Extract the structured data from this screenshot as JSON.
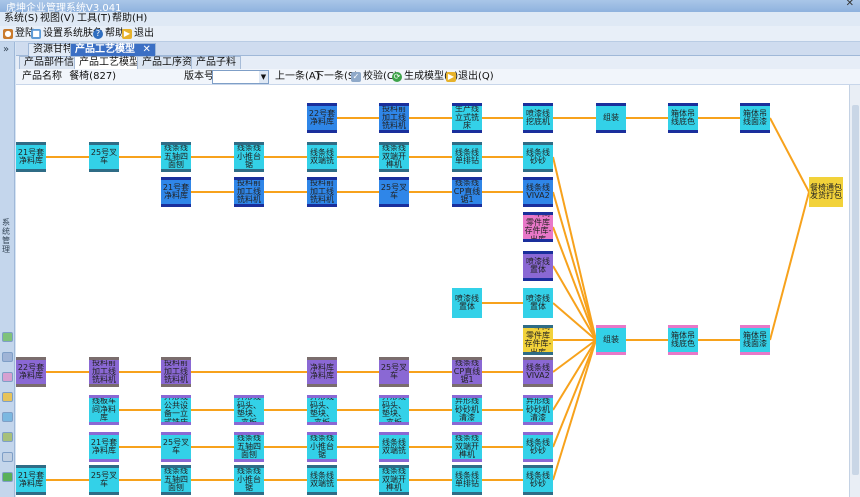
{
  "window": {
    "title": "虎坤企业管理系统V3.041",
    "close_glyph": "✕"
  },
  "menu": [
    "系统(S)",
    "视图(V)",
    "工具(T)",
    "帮助(H)"
  ],
  "toolbar": {
    "logout": "登陆",
    "theme": "设置系统肤色",
    "help": "帮助",
    "exit": "退出"
  },
  "left_strip": {
    "chevron": "»",
    "vertical_label": "系统管理"
  },
  "doc_tabs": [
    {
      "label": "资源甘特图"
    },
    {
      "label": "产品工艺模型"
    }
  ],
  "doc_tab_close": "✕",
  "sub_tabs": [
    "产品部件信息",
    "产品工艺模型图",
    "产品工序资料",
    "产品子料"
  ],
  "params": {
    "product_name_label": "产品名称",
    "product_name_value": "餐椅(827)",
    "version_label": "版本号",
    "version_value": "",
    "prev": "上一条(A)",
    "next": "下一条(S)",
    "check": "校验(C)",
    "generate": "生成模型(E)",
    "exit": "退出(Q)"
  },
  "colors": {
    "cyan": "#33d1e8",
    "blue": "#2f86e8",
    "purple": "#8a68d4",
    "pink": "#e878c8",
    "teal_band": "#2f6c86",
    "dark_band": "#1a2f9c",
    "gray_band": "#7a6d6d",
    "yellow": "#f2d23a",
    "orange_edge": "#f7a21c"
  },
  "nodes": [
    {
      "id": "n1",
      "label": "22号套净料库",
      "col": 6,
      "row": 0,
      "style": "blue",
      "band": "dark"
    },
    {
      "id": "n2",
      "label": "投料前加工线铣料机",
      "col": 7,
      "row": 0,
      "style": "blue",
      "band": "dark"
    },
    {
      "id": "n3",
      "label": "生产线立式铣床",
      "col": 8,
      "row": 0,
      "style": "cyan",
      "band": "dark"
    },
    {
      "id": "n4",
      "label": "喷漆线挖底机",
      "col": 9,
      "row": 0,
      "style": "cyan",
      "band": "dark"
    },
    {
      "id": "n5",
      "label": "组装",
      "col": 10,
      "row": 0,
      "style": "cyan",
      "band": "dark"
    },
    {
      "id": "n6",
      "label": "箱体吊线底色",
      "col": 11,
      "row": 0,
      "style": "cyan",
      "band": "dark"
    },
    {
      "id": "n7",
      "label": "箱体吊线面漆",
      "col": 12,
      "row": 0,
      "style": "cyan",
      "band": "dark"
    },
    {
      "id": "n8",
      "label": "21号套净料库",
      "col": 0,
      "row": 1,
      "style": "cyan",
      "band": "teal"
    },
    {
      "id": "n9",
      "label": "25号叉车",
      "col": 2,
      "row": 1,
      "style": "cyan",
      "band": "teal"
    },
    {
      "id": "n10",
      "label": "线条线五轴四面刨",
      "col": 4,
      "row": 1,
      "style": "cyan",
      "band": "teal"
    },
    {
      "id": "n11",
      "label": "线条线小推台锯",
      "col": 5,
      "row": 1,
      "style": "cyan",
      "band": "teal"
    },
    {
      "id": "n12",
      "label": "线条线双端铣",
      "col": 6,
      "row": 1,
      "style": "cyan",
      "band": "teal"
    },
    {
      "id": "n13",
      "label": "线条线双端开榫机",
      "col": 7,
      "row": 1,
      "style": "cyan",
      "band": "teal"
    },
    {
      "id": "n14",
      "label": "线条线单排钻",
      "col": 8,
      "row": 1,
      "style": "cyan",
      "band": "teal"
    },
    {
      "id": "n15",
      "label": "线条线砂砂",
      "col": 9,
      "row": 1,
      "style": "cyan",
      "band": "teal"
    },
    {
      "id": "n16",
      "label": "21号套净料库",
      "col": 4,
      "row": 2,
      "style": "blue",
      "band": "dark"
    },
    {
      "id": "n17",
      "label": "投料前加工线铣料机",
      "col": 5,
      "row": 2,
      "style": "blue",
      "band": "dark"
    },
    {
      "id": "n18",
      "label": "投料前加工线铣料机",
      "col": 6,
      "row": 2,
      "style": "blue",
      "band": "dark"
    },
    {
      "id": "n19",
      "label": "25号叉车",
      "col": 7,
      "row": 2,
      "style": "blue",
      "band": "dark"
    },
    {
      "id": "n20",
      "label": "线条线CP直线锯1",
      "col": 8,
      "row": 2,
      "style": "blue",
      "band": "dark"
    },
    {
      "id": "n21",
      "label": "线条线VIVA2",
      "col": 9,
      "row": 2,
      "style": "blue",
      "band": "dark"
    },
    {
      "id": "n22",
      "label": "餐椅通包发货打包",
      "col": 13,
      "row": 2,
      "style": "yellow",
      "band": "none"
    },
    {
      "id": "n23",
      "label": "一车间零件库存件库-出库",
      "col": 9,
      "row": 3,
      "style": "pink",
      "band": "dark"
    },
    {
      "id": "n24",
      "label": "喷漆线置体",
      "col": 9,
      "row": 4,
      "style": "purple",
      "band": "dark"
    },
    {
      "id": "n25",
      "label": "喷漆线置体",
      "col": 8,
      "row": 5,
      "style": "cyan",
      "band": "none"
    },
    {
      "id": "n26",
      "label": "喷漆线置体",
      "col": 9,
      "row": 5,
      "style": "cyan",
      "band": "none"
    },
    {
      "id": "n27",
      "label": "一车间零件库存件库-出库",
      "col": 9,
      "row": 6,
      "style": "yellow",
      "band": "teal"
    },
    {
      "id": "n28",
      "label": "组装",
      "col": 10,
      "row": 6,
      "style": "cyan",
      "band": "pink"
    },
    {
      "id": "n29",
      "label": "箱体吊线底色",
      "col": 11,
      "row": 6,
      "style": "cyan",
      "band": "pink"
    },
    {
      "id": "n30",
      "label": "箱体吊线面漆",
      "col": 12,
      "row": 6,
      "style": "cyan",
      "band": "pink"
    },
    {
      "id": "n31",
      "label": "22号套净料库",
      "col": 0,
      "row": 7,
      "style": "purple",
      "band": "gray"
    },
    {
      "id": "n32",
      "label": "投料前加工线铣料机",
      "col": 2,
      "row": 7,
      "style": "purple",
      "band": "gray"
    },
    {
      "id": "n33",
      "label": "投料前加工线铣料机",
      "col": 4,
      "row": 7,
      "style": "purple",
      "band": "gray"
    },
    {
      "id": "n34",
      "label": "净料库净料库",
      "col": 6,
      "row": 7,
      "style": "purple",
      "band": "gray"
    },
    {
      "id": "n35",
      "label": "25号叉车",
      "col": 7,
      "row": 7,
      "style": "purple",
      "band": "gray"
    },
    {
      "id": "n36",
      "label": "线条线CP直线锯1",
      "col": 8,
      "row": 7,
      "style": "purple",
      "band": "gray"
    },
    {
      "id": "n37",
      "label": "线条线VIVA2",
      "col": 9,
      "row": 7,
      "style": "purple",
      "band": "gray"
    },
    {
      "id": "n38",
      "label": "线板车间净料库",
      "col": 2,
      "row": 8,
      "style": "cyan",
      "band": "purple"
    },
    {
      "id": "n39",
      "label": "异形线公共设备一立式铣床",
      "col": 4,
      "row": 8,
      "style": "cyan",
      "band": "purple"
    },
    {
      "id": "n40",
      "label": "异形线码头、垫块、夹板",
      "col": 5,
      "row": 8,
      "style": "cyan",
      "band": "purple"
    },
    {
      "id": "n41",
      "label": "异形线码头、垫块、夹板",
      "col": 6,
      "row": 8,
      "style": "cyan",
      "band": "purple"
    },
    {
      "id": "n42",
      "label": "异形线码头、垫块、夹板",
      "col": 7,
      "row": 8,
      "style": "cyan",
      "band": "purple"
    },
    {
      "id": "n43",
      "label": "异形线砂砂机清漆",
      "col": 8,
      "row": 8,
      "style": "cyan",
      "band": "purple"
    },
    {
      "id": "n44",
      "label": "异形线砂砂机清漆",
      "col": 9,
      "row": 8,
      "style": "cyan",
      "band": "purple"
    },
    {
      "id": "n45",
      "label": "21号套净料库",
      "col": 2,
      "row": 9,
      "style": "cyan",
      "band": "purple"
    },
    {
      "id": "n46",
      "label": "25号叉车",
      "col": 4,
      "row": 9,
      "style": "cyan",
      "band": "purple"
    },
    {
      "id": "n47",
      "label": "线条线五轴四面刨",
      "col": 5,
      "row": 9,
      "style": "cyan",
      "band": "purple"
    },
    {
      "id": "n48",
      "label": "线条线小推台锯",
      "col": 6,
      "row": 9,
      "style": "cyan",
      "band": "purple"
    },
    {
      "id": "n49",
      "label": "线条线双端铣",
      "col": 7,
      "row": 9,
      "style": "cyan",
      "band": "purple"
    },
    {
      "id": "n50",
      "label": "线条线双端开榫机",
      "col": 8,
      "row": 9,
      "style": "cyan",
      "band": "purple"
    },
    {
      "id": "n51",
      "label": "线条线砂砂",
      "col": 9,
      "row": 9,
      "style": "cyan",
      "band": "purple"
    },
    {
      "id": "n52",
      "label": "21号套净料库",
      "col": 0,
      "row": 10,
      "style": "cyan",
      "band": "teal"
    },
    {
      "id": "n53",
      "label": "25号叉车",
      "col": 2,
      "row": 10,
      "style": "cyan",
      "band": "teal"
    },
    {
      "id": "n54",
      "label": "线条线五轴四面刨",
      "col": 4,
      "row": 10,
      "style": "cyan",
      "band": "teal"
    },
    {
      "id": "n55",
      "label": "线条线小推台锯",
      "col": 5,
      "row": 10,
      "style": "cyan",
      "band": "teal"
    },
    {
      "id": "n56",
      "label": "线条线双端铣",
      "col": 6,
      "row": 10,
      "style": "cyan",
      "band": "teal"
    },
    {
      "id": "n57",
      "label": "线条线双端开榫机",
      "col": 7,
      "row": 10,
      "style": "cyan",
      "band": "teal"
    },
    {
      "id": "n58",
      "label": "线条线单排钻",
      "col": 8,
      "row": 10,
      "style": "cyan",
      "band": "teal"
    },
    {
      "id": "n59",
      "label": "线条线砂砂",
      "col": 9,
      "row": 10,
      "style": "cyan",
      "band": "teal"
    }
  ],
  "edges": [
    [
      "n1",
      "n2"
    ],
    [
      "n2",
      "n3"
    ],
    [
      "n3",
      "n4"
    ],
    [
      "n4",
      "n5"
    ],
    [
      "n5",
      "n6"
    ],
    [
      "n6",
      "n7"
    ],
    [
      "n7",
      "n22"
    ],
    [
      "n8",
      "n9"
    ],
    [
      "n9",
      "n10"
    ],
    [
      "n10",
      "n11"
    ],
    [
      "n11",
      "n12"
    ],
    [
      "n12",
      "n13"
    ],
    [
      "n13",
      "n14"
    ],
    [
      "n14",
      "n15"
    ],
    [
      "n15",
      "n28"
    ],
    [
      "n16",
      "n17"
    ],
    [
      "n17",
      "n18"
    ],
    [
      "n18",
      "n19"
    ],
    [
      "n19",
      "n20"
    ],
    [
      "n20",
      "n21"
    ],
    [
      "n21",
      "n28"
    ],
    [
      "n23",
      "n28"
    ],
    [
      "n24",
      "n28"
    ],
    [
      "n25",
      "n26"
    ],
    [
      "n26",
      "n28"
    ],
    [
      "n27",
      "n28"
    ],
    [
      "n28",
      "n29"
    ],
    [
      "n29",
      "n30"
    ],
    [
      "n30",
      "n22"
    ],
    [
      "n31",
      "n32"
    ],
    [
      "n32",
      "n33"
    ],
    [
      "n33",
      "n34"
    ],
    [
      "n34",
      "n35"
    ],
    [
      "n35",
      "n36"
    ],
    [
      "n36",
      "n37"
    ],
    [
      "n37",
      "n28"
    ],
    [
      "n38",
      "n39"
    ],
    [
      "n39",
      "n40"
    ],
    [
      "n40",
      "n41"
    ],
    [
      "n41",
      "n42"
    ],
    [
      "n42",
      "n43"
    ],
    [
      "n43",
      "n44"
    ],
    [
      "n44",
      "n28"
    ],
    [
      "n45",
      "n46"
    ],
    [
      "n46",
      "n47"
    ],
    [
      "n47",
      "n48"
    ],
    [
      "n48",
      "n49"
    ],
    [
      "n49",
      "n50"
    ],
    [
      "n50",
      "n51"
    ],
    [
      "n51",
      "n28"
    ],
    [
      "n52",
      "n53"
    ],
    [
      "n53",
      "n54"
    ],
    [
      "n54",
      "n55"
    ],
    [
      "n55",
      "n56"
    ],
    [
      "n56",
      "n57"
    ],
    [
      "n57",
      "n58"
    ],
    [
      "n58",
      "n59"
    ],
    [
      "n59",
      "n28"
    ]
  ]
}
